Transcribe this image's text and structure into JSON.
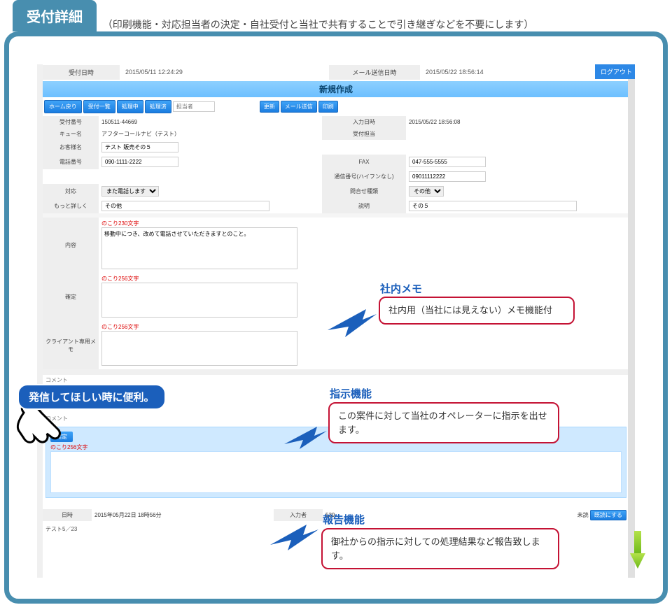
{
  "page": {
    "tab_title": "受付詳細",
    "subtitle": "（印刷機能・対応担当者の決定・自社受付と当社で共有することで引き継ぎなどを不要にします）"
  },
  "header": {
    "recv_date_label": "受付日時",
    "recv_date_value": "2015/05/11 12:24:29",
    "mail_date_label": "メール送信日時",
    "mail_date_value": "2015/05/22 18:56:14",
    "logout_label": "ログアウト"
  },
  "banner": {
    "title": "新規作成"
  },
  "actions": {
    "home": "ホーム戻り",
    "list": "受付一覧",
    "processing": "処理中",
    "done": "処理済",
    "assignee_placeholder": "担当者",
    "update": "更新",
    "mail": "メール送信",
    "print": "印刷"
  },
  "form": {
    "left": {
      "recv_no_label": "受付番号",
      "recv_no_value": "150511-44669",
      "queue_label": "キュー名",
      "queue_value": "アフターコールナビ（テスト）",
      "customer_label": "お客様名",
      "customer_value": "テスト 販売その５",
      "phone_label": "電話番号",
      "phone_value": "090-1111-2222",
      "handle_label": "対応",
      "handle_value": "また電話します",
      "more_label": "もっと詳しく",
      "more_value": "その他"
    },
    "right": {
      "input_dt_label": "入力日時",
      "input_dt_value": "2015/05/22 18:56:08",
      "agent_label": "受付担当",
      "fax_label": "FAX",
      "fax_value": "047-555-5555",
      "callback_label": "通信番号(ハイフンなし)",
      "callback_value": "09011112222",
      "inq_type_label": "問合せ種類",
      "inq_type_value": "その他",
      "desc_label": "説明",
      "desc_value": "その５"
    },
    "memo": {
      "content_label": "内容",
      "content_hint": "のこり230文字",
      "content_value": "移動中につき、改めて電話させていただきますとのこと。",
      "confirm_label": "確定",
      "confirm_hint": "のこり256文字",
      "client_label": "クライアント専用メモ",
      "client_hint": "のこり256文字"
    }
  },
  "comment": {
    "section_label": "コメント",
    "box_tag": "実定",
    "box_hint": "のこり256文字",
    "date_label": "日時",
    "date_value": "2015年05月22日 18時56分",
    "inputter_label": "入力者",
    "inputter_value": "539",
    "unread": "未読",
    "mark_read": "既読にする",
    "test_line": "テスト5／23"
  },
  "callouts": {
    "memo_title": "社内メモ",
    "memo_text": "社内用（当社には見えない）メモ機能付",
    "inst_title": "指示機能",
    "inst_text": "この案件に対して当社のオペレーターに指示を出せます。",
    "rep_title": "報告機能",
    "rep_text": "御社からの指示に対しての処理結果など報告致します。",
    "pill": "発信してほしい時に便利。"
  }
}
